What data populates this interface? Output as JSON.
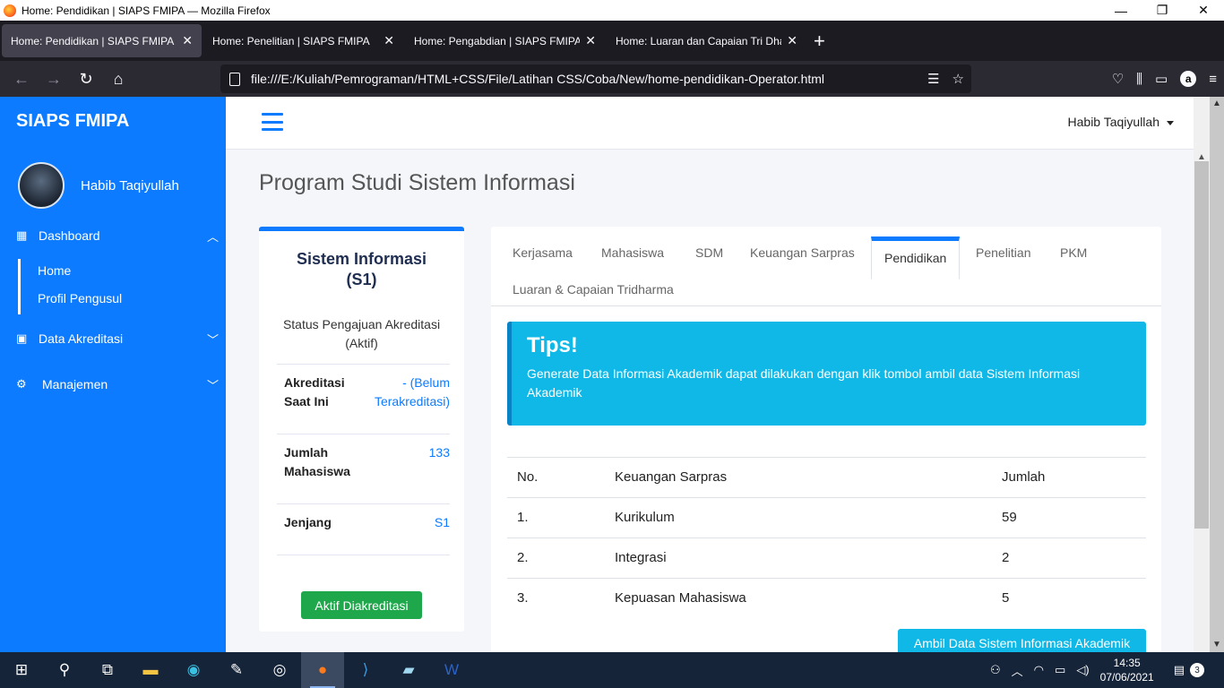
{
  "window": {
    "title": "Home: Pendidikan | SIAPS FMIPA — Mozilla Firefox"
  },
  "tabs": [
    {
      "label": "Home: Pendidikan | SIAPS FMIPA",
      "active": true
    },
    {
      "label": "Home: Penelitian | SIAPS FMIPA",
      "active": false
    },
    {
      "label": "Home: Pengabdian | SIAPS FMIPA",
      "active": false
    },
    {
      "label": "Home: Luaran dan Capaian Tri Dharma",
      "active": false
    }
  ],
  "url": "file:///E:/Kuliah/Pemrograman/HTML+CSS/File/Latihan CSS/Coba/New/home-pendidikan-Operator.html",
  "sidebar": {
    "brand": "SIAPS FMIPA",
    "user": "Habib Taqiyullah",
    "menu": {
      "dashboard": "Dashboard",
      "home": "Home",
      "profil": "Profil Pengusul",
      "data_akreditasi": "Data Akreditasi",
      "manajemen": "Manajemen"
    }
  },
  "topnav": {
    "user": "Habib Taqiyullah"
  },
  "page": {
    "title": "Program Studi Sistem Informasi"
  },
  "prodi_card": {
    "name_line1": "Sistem Informasi",
    "name_line2": "(S1)",
    "status_line1": "Status Pengajuan Akreditasi",
    "status_line2": "(Aktif)",
    "rows": [
      {
        "key_line1": "Akreditasi",
        "key_line2": "Saat Ini",
        "value_line1": "- (Belum",
        "value_line2": "Terakreditasi)"
      },
      {
        "key_line1": "Jumlah",
        "key_line2": "Mahasiswa",
        "value_line1": "133",
        "value_line2": ""
      },
      {
        "key_line1": "Jenjang",
        "key_line2": "",
        "value_line1": "S1",
        "value_line2": ""
      }
    ],
    "button": "Aktif Diakreditasi"
  },
  "nav_tabs": [
    "Kerjasama",
    "Mahasiswa",
    "SDM",
    "Keuangan Sarpras",
    "Pendidikan",
    "Penelitian",
    "PKM",
    "Luaran & Capaian Tridharma"
  ],
  "tips": {
    "title": "Tips!",
    "text": "Generate Data Informasi Akademik dapat dilakukan dengan klik tombol ambil data Sistem Informasi Akademik"
  },
  "table": {
    "headers": [
      "No.",
      "Keuangan Sarpras",
      "Jumlah"
    ],
    "rows": [
      [
        "1.",
        "Kurikulum",
        "59"
      ],
      [
        "2.",
        "Integrasi",
        "2"
      ],
      [
        "3.",
        "Kepuasan Mahasiswa",
        "5"
      ]
    ]
  },
  "action_button": "Ambil Data Sistem Informasi Akademik",
  "taskbar": {
    "time": "14:35",
    "date": "07/06/2021",
    "notifications": "3"
  }
}
